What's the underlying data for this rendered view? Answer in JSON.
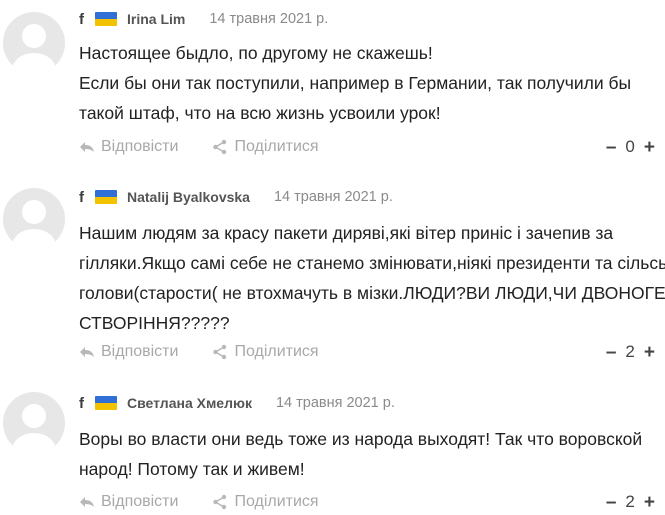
{
  "comments": [
    {
      "network": "f",
      "author": "Irina Lim",
      "date": "14 травня 2021 р.",
      "text": "Настоящее быдло, по другому не скажешь!\nЕсли бы они так поступили, например в Германии, так получили бы такой штаф, что на всю жизнь усвоили урок!",
      "reply_label": "Відповісти",
      "share_label": "Поділитися",
      "minus": "–",
      "score": "0",
      "plus": "+"
    },
    {
      "network": "f",
      "author": "Natalij Byalkovska",
      "date": "14 травня 2021 р.",
      "text": "Нашим людям за красу пакети диряві,які вітер приніс і зачепив за гілляки.Якщо самі себе не станемо змінювати,ніякі президенти та сільські голови(старости( не втохмачуть в мізки.ЛЮДИ?ВИ ЛЮДИ,ЧИ ДВОНОГЕ СТВОРІННЯ?????",
      "reply_label": "Відповісти",
      "share_label": "Поділитися",
      "minus": "–",
      "score": "2",
      "plus": "+"
    },
    {
      "network": "f",
      "author": "Светлана Хмелюк",
      "date": "14 травня 2021 р.",
      "text": "Воры во власти они ведь тоже из народа выходят! Так что воровской народ! Потому так  и живем!",
      "reply_label": "Відповісти",
      "share_label": "Поділитися",
      "minus": "–",
      "score": "2",
      "plus": "+"
    }
  ],
  "colors": {
    "flag_blue": "#2f6fd6",
    "flag_yellow": "#f2c200",
    "avatar_bg": "#e7e7e7",
    "avatar_fg": "#ffffff",
    "action_text": "#a8a8a8",
    "date_text": "#8a8a8a"
  },
  "icons": {
    "network": "facebook-icon",
    "flag": "ukraine-flag-icon",
    "reply": "reply-arrow-icon",
    "share": "share-icon",
    "avatar": "default-user-avatar-icon"
  }
}
